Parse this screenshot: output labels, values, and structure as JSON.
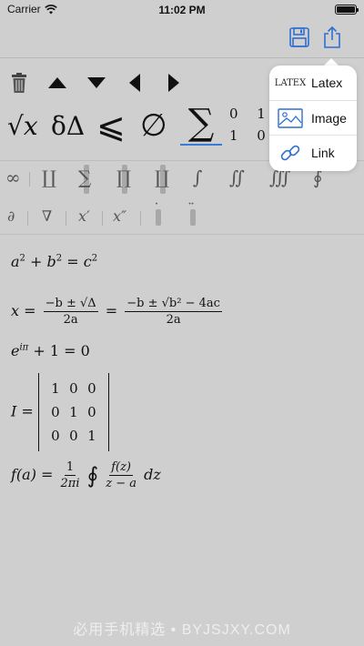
{
  "status_bar": {
    "carrier": "Carrier",
    "time": "11:02 PM",
    "battery_level": 1.0
  },
  "icons": {
    "save": "floppy-disk-icon",
    "share": "share-icon",
    "trash": "trash-icon",
    "arrow_up": "arrow-up-icon",
    "arrow_down": "arrow-down-icon",
    "arrow_left": "arrow-left-icon",
    "arrow_right": "arrow-right-icon",
    "wifi": "wifi-icon",
    "latex": "latex-icon",
    "image": "image-icon",
    "link": "link-icon"
  },
  "accent_color": "#3a7bd5",
  "symbols": {
    "sqrt": "√x",
    "delta": "δΔ",
    "leqslant": "⩽",
    "emptyset": "∅",
    "sum": "∑",
    "matrix_r1": "0 1",
    "matrix_r2": "1 0"
  },
  "operators": {
    "infinity": "∞",
    "coproduct": "∐",
    "sum": "∑",
    "product": "∏",
    "coproduct2": "∐",
    "integral": "∫",
    "double_integral": "∬",
    "triple_integral": "∭",
    "contour_integral": "∮"
  },
  "operators2": {
    "partial": "∂",
    "nabla": "∇",
    "prime": "x′",
    "double_prime": "x″",
    "dot": "˙",
    "ddot": "¨"
  },
  "equations": {
    "pythagoras": {
      "a": "a",
      "b": "b",
      "c": "c",
      "exp": "2",
      "plus": "+",
      "eq": "="
    },
    "quadratic": {
      "x": "x",
      "eq": "=",
      "num1": "−b ± √Δ",
      "den1": "2a",
      "num2": "−b ± √b² − 4ac",
      "den2": "2a"
    },
    "euler": {
      "base": "e",
      "exp": "iπ",
      "rest": "+ 1 = 0"
    },
    "identity": {
      "label": "I =",
      "rows": [
        [
          "1",
          "0",
          "0"
        ],
        [
          "0",
          "1",
          "0"
        ],
        [
          "0",
          "0",
          "1"
        ]
      ]
    },
    "cauchy": {
      "lhs": "f(a) =",
      "num1": "1",
      "den1": "2πi",
      "integral": "∮",
      "num2": "f(z)",
      "den2": "z − a",
      "dz": "dz"
    }
  },
  "popover": {
    "items": [
      {
        "label": "Latex",
        "icon": "latex-icon",
        "icon_text": "LATEX"
      },
      {
        "label": "Image",
        "icon": "image-icon"
      },
      {
        "label": "Link",
        "icon": "link-icon"
      }
    ]
  },
  "watermark": "必用手机精选 • BYJSJXY.COM"
}
